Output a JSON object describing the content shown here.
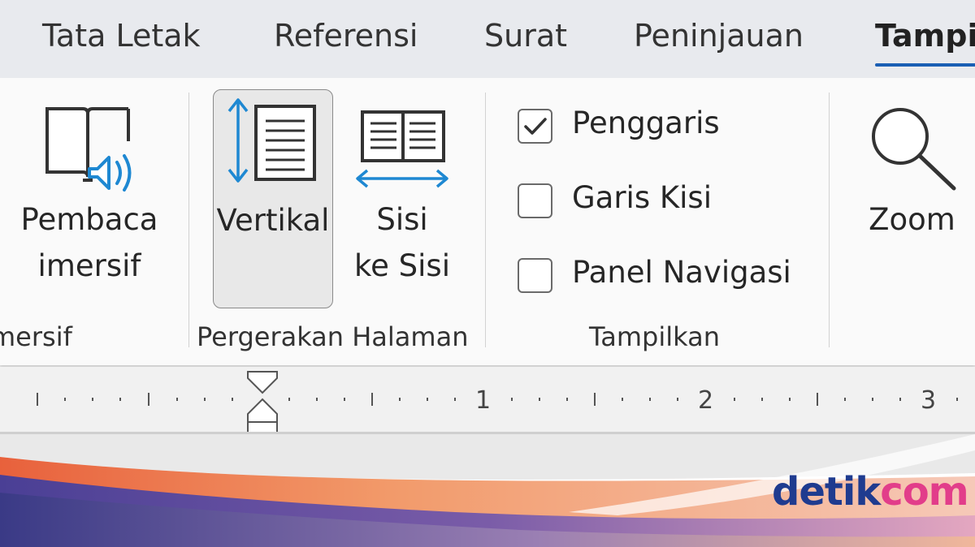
{
  "tabs": {
    "layout": "Tata Letak",
    "references": "Referensi",
    "mailings": "Surat",
    "review": "Peninjauan",
    "view": "Tampi"
  },
  "ribbon": {
    "immersive": {
      "reader_line1": "Pembaca",
      "reader_line2": "imersif",
      "group_label": "mersif"
    },
    "page_movement": {
      "vertical": "Vertikal",
      "side_line1": "Sisi",
      "side_line2": "ke Sisi",
      "group_label": "Pergerakan Halaman"
    },
    "show": {
      "ruler": "Penggaris",
      "gridlines": "Garis Kisi",
      "nav_pane": "Panel Navigasi",
      "group_label": "Tampilkan",
      "ruler_checked": true,
      "gridlines_checked": false,
      "nav_pane_checked": false
    },
    "zoom": {
      "label": "Zoom"
    }
  },
  "ruler": {
    "n1": "1",
    "n2": "2",
    "n3": "3"
  },
  "banner": {
    "logo_part1": "detik",
    "logo_part2": "com"
  },
  "colors": {
    "accent": "#1a5fb4",
    "icon_blue": "#1e88d2",
    "logo_blue": "#1f3b8f",
    "logo_pink": "#e23d8a"
  }
}
